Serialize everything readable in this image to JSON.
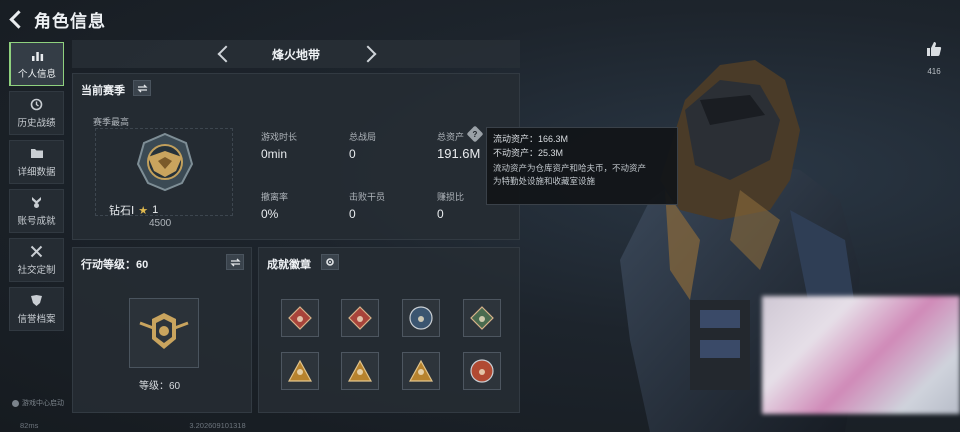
{
  "header": {
    "title": "角色信息"
  },
  "sidebar": {
    "items": [
      {
        "label": "个人信息",
        "icon": "bar-chart-icon",
        "active": true
      },
      {
        "label": "历史战绩",
        "icon": "clock-icon",
        "active": false
      },
      {
        "label": "详细数据",
        "icon": "folder-icon",
        "active": false
      },
      {
        "label": "账号成就",
        "icon": "medal-icon",
        "active": false
      },
      {
        "label": "社交定制",
        "icon": "tools-icon",
        "active": false
      },
      {
        "label": "信誉档案",
        "icon": "shield-icon",
        "active": false
      }
    ],
    "footer": "游戏中心启动"
  },
  "bottom": {
    "ping": "82ms",
    "version": "3.202609101318"
  },
  "map": {
    "name": "烽火地带"
  },
  "season": {
    "title": "当前赛季",
    "best_label": "赛季最高",
    "rank": "钻石Ⅰ",
    "stars": "1",
    "score": "4500",
    "stats": [
      {
        "label": "游戏时长",
        "value": "0min"
      },
      {
        "label": "总战局",
        "value": "0"
      },
      {
        "label": "总资产",
        "value": "191.6M"
      },
      {
        "label": "撤离率",
        "value": "0%"
      },
      {
        "label": "击败干员",
        "value": "0"
      },
      {
        "label": "赚损比",
        "value": "0"
      }
    ]
  },
  "tooltip": {
    "liquid": "流动资产：166.3M",
    "fixed": "不动资产：25.3M",
    "desc_line1": "流动资产为仓库资产和哈夫币，不动资产",
    "desc_line2": "为特勤处设施和收藏室设施"
  },
  "action_level": {
    "title": "行动等级：60",
    "level_text": "等级：60"
  },
  "achievements": {
    "title": "成就徽章",
    "badges": [
      {
        "icon": "badge-diamond-red-icon",
        "color": "#a8443a"
      },
      {
        "icon": "badge-diamond-red-icon",
        "color": "#a8443a"
      },
      {
        "icon": "badge-round-blue-icon",
        "color": "#3b5570"
      },
      {
        "icon": "badge-diamond-green-icon",
        "color": "#4a6b4f"
      },
      {
        "icon": "badge-triangle-gold-icon",
        "color": "#b7832e"
      },
      {
        "icon": "badge-triangle-gold-icon",
        "color": "#b7832e"
      },
      {
        "icon": "badge-triangle-gold-icon",
        "color": "#b7832e"
      },
      {
        "icon": "badge-round-gold-icon",
        "color": "#b14a32"
      }
    ]
  },
  "likes": {
    "count": "416"
  },
  "colors": {
    "accent": "#8fd17e",
    "panel": "#252c33"
  }
}
